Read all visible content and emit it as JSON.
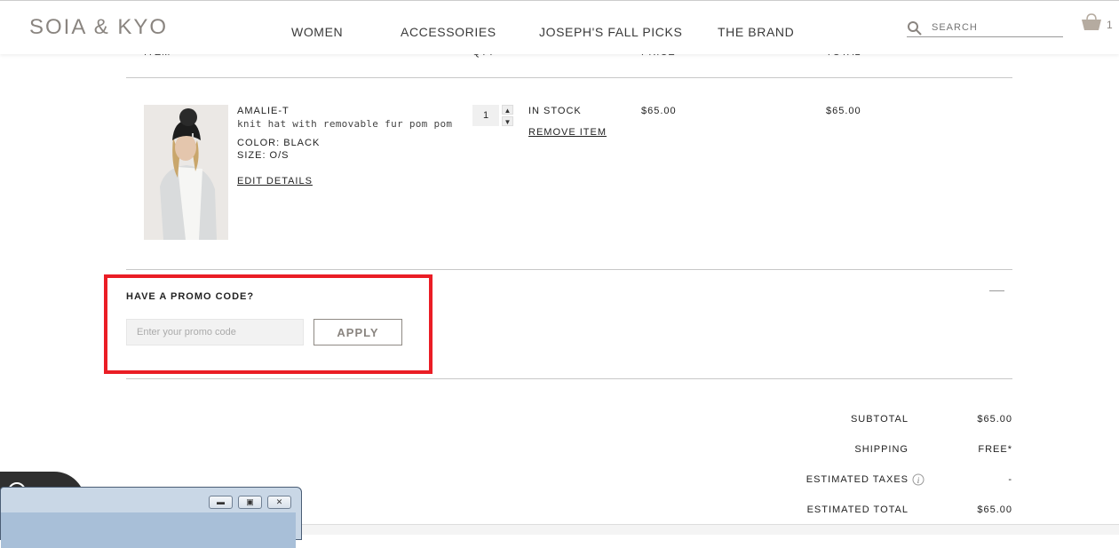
{
  "header": {
    "logo": "SOIA & KYO",
    "nav": [
      "WOMEN",
      "ACCESSORIES",
      "JOSEPH'S FALL PICKS",
      "THE BRAND"
    ],
    "search_placeholder": "SEARCH",
    "cart_count": "1",
    "icons": [
      "search-icon",
      "cart-icon"
    ]
  },
  "cart": {
    "columns": [
      "ITEM",
      "QTY",
      "PRICE",
      "TOTAL"
    ],
    "item": {
      "name": "AMALIE-T",
      "description": "knit hat with removable fur pom pom",
      "color": "COLOR: BLACK",
      "size": "SIZE: O/S",
      "edit_label": "EDIT DETAILS",
      "qty": "1",
      "stock": "IN STOCK",
      "remove_label": "REMOVE ITEM",
      "price": "$65.00",
      "total": "$65.00"
    }
  },
  "promo": {
    "heading": "HAVE A PROMO CODE?",
    "placeholder": "Enter your promo code",
    "apply_label": "APPLY",
    "highlight_color": "#ea1d25"
  },
  "summary": {
    "rows": [
      {
        "label": "SUBTOTAL",
        "value": "$65.00"
      },
      {
        "label": "SHIPPING",
        "value": "FREE*"
      },
      {
        "label": "ESTIMATED TAXES",
        "value": "-"
      },
      {
        "label": "ESTIMATED TOTAL",
        "value": "$65.00"
      }
    ]
  },
  "colors": {
    "brand": "#8a8580",
    "text": "#222222",
    "divider": "#c8c8c8"
  }
}
